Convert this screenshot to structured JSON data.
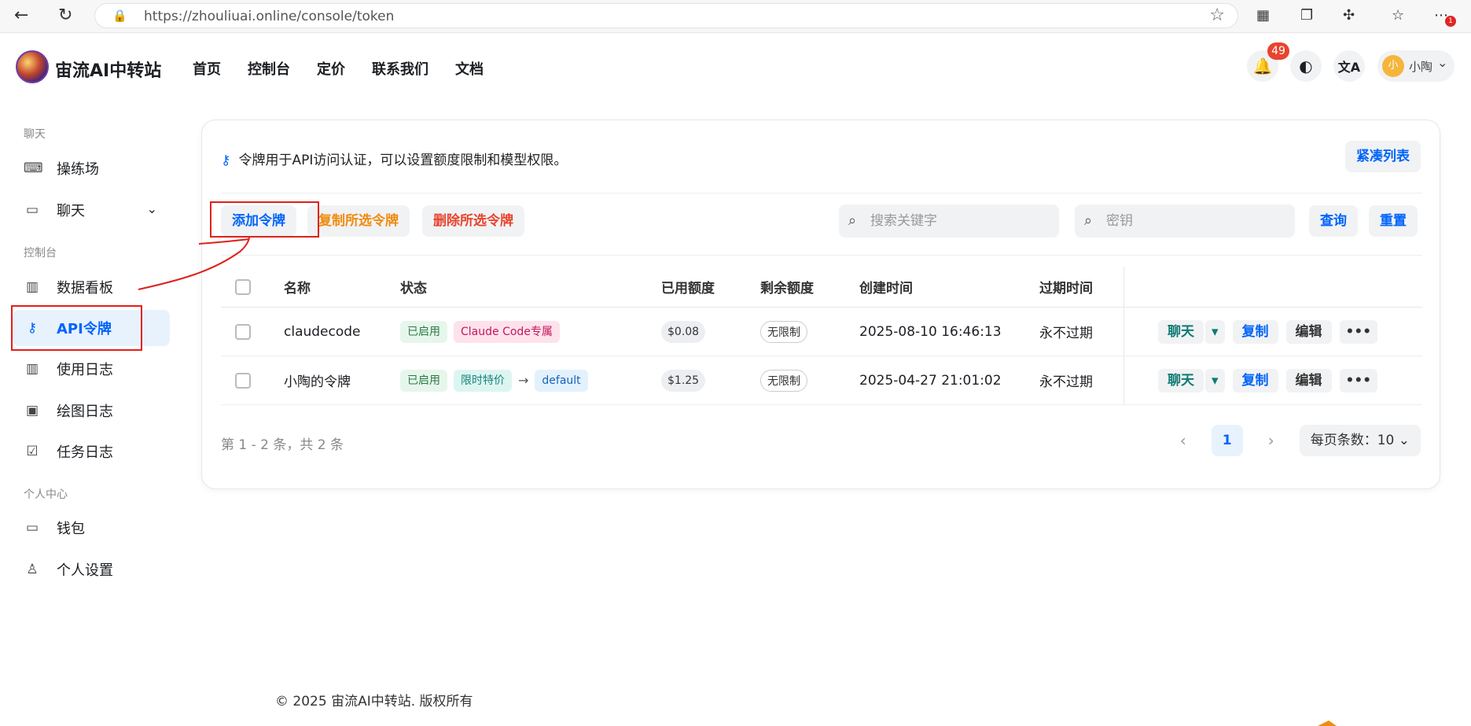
{
  "browser": {
    "url": "https://zhouliuai.online/console/token",
    "ext_badge": "1"
  },
  "nav": {
    "brand": "宙流AI中转站",
    "links": [
      "首页",
      "控制台",
      "定价",
      "联系我们",
      "文档"
    ],
    "notification_count": "49",
    "user_initial": "小",
    "user_name": "小陶"
  },
  "sidebar": {
    "sections": [
      "聊天",
      "控制台",
      "个人中心"
    ],
    "items": [
      {
        "label": "操练场",
        "icon": "terminal-icon"
      },
      {
        "label": "聊天",
        "icon": "chat-bubble-icon"
      },
      {
        "label": "数据看板",
        "icon": "bar-chart-icon"
      },
      {
        "label": "API令牌",
        "icon": "key-icon",
        "active": true
      },
      {
        "label": "使用日志",
        "icon": "bar-chart-icon"
      },
      {
        "label": "绘图日志",
        "icon": "image-icon"
      },
      {
        "label": "任务日志",
        "icon": "checkbox-icon"
      },
      {
        "label": "钱包",
        "icon": "wallet-icon"
      },
      {
        "label": "个人设置",
        "icon": "user-icon"
      }
    ]
  },
  "main": {
    "description": "令牌用于API访问认证，可以设置额度限制和模型权限。",
    "compact_label": "紧凑列表",
    "actions": {
      "add": "添加令牌",
      "copy_selected": "复制所选令牌",
      "delete_selected": "删除所选令牌"
    },
    "search_keyword_placeholder": "搜索关键字",
    "search_key_placeholder": "密钥",
    "query_label": "查询",
    "reset_label": "重置",
    "columns": [
      "名称",
      "状态",
      "已用额度",
      "剩余额度",
      "创建时间",
      "过期时间"
    ],
    "rows": [
      {
        "name": "claudecode",
        "status": "已启用",
        "group": "Claude Code专属",
        "group_target": "",
        "used": "$0.08",
        "remaining": "无限制",
        "created": "2025-08-10 16:46:13",
        "expires": "永不过期"
      },
      {
        "name": "小陶的令牌",
        "status": "已启用",
        "group": "限时特价",
        "group_target": "default",
        "used": "$1.25",
        "remaining": "无限制",
        "created": "2025-04-27 21:01:02",
        "expires": "永不过期"
      }
    ],
    "row_actions": {
      "chat": "聊天",
      "copy": "复制",
      "edit": "编辑"
    },
    "footer_count": "第 1 - 2 条，共 2 条",
    "current_page": "1",
    "page_size": "每页条数：10"
  },
  "colors": {
    "primary": "#0064fa",
    "copy_action": "#f08b0c",
    "delete_action": "#e8442e",
    "chat_action": "#0f7a73",
    "annotation": "#e0201a"
  },
  "copyright": "© 2025 宙流AI中转站. 版权所有"
}
